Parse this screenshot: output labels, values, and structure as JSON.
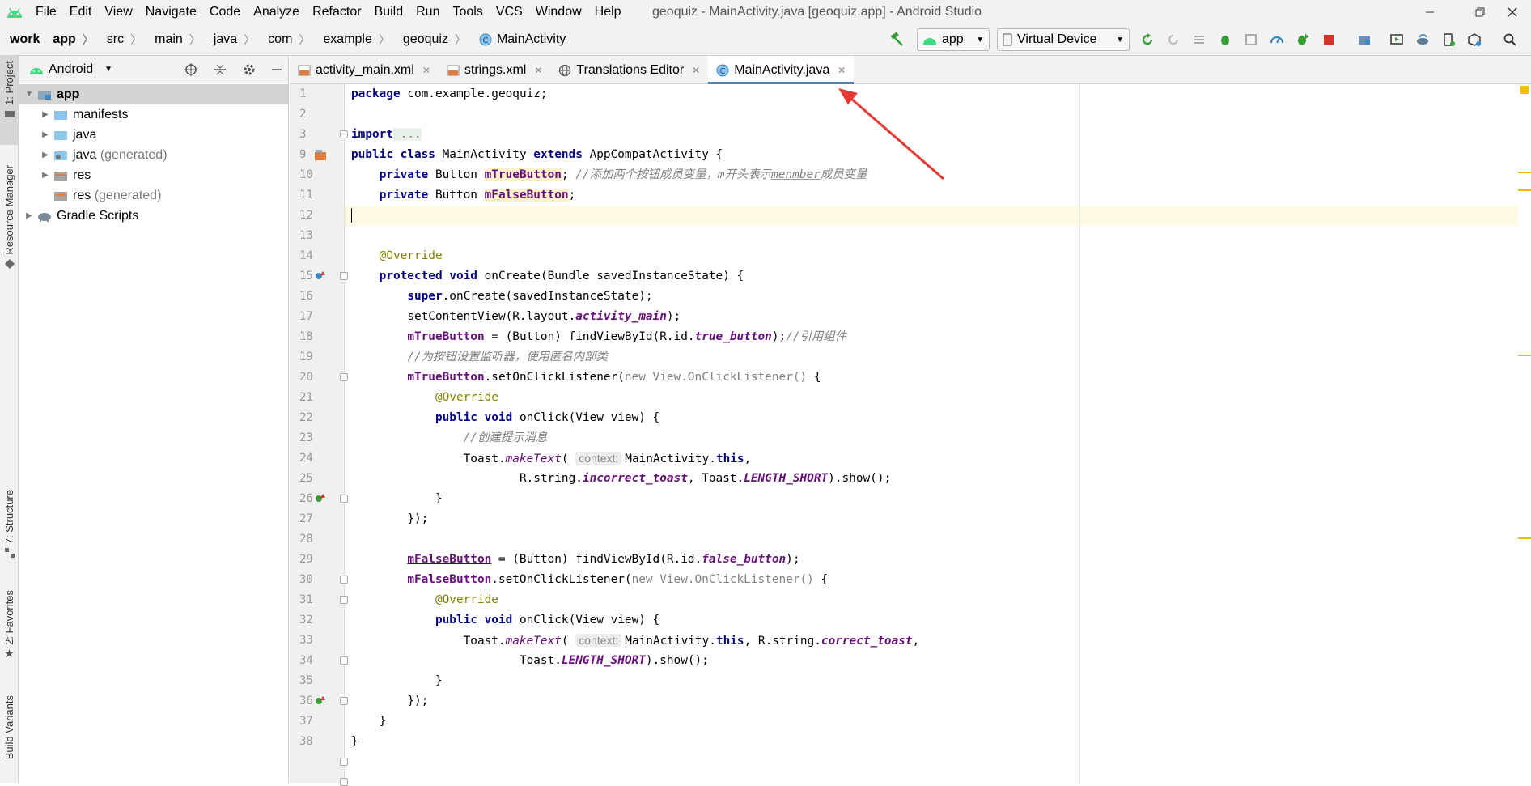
{
  "menu": {
    "items": [
      "File",
      "Edit",
      "View",
      "Navigate",
      "Code",
      "Analyze",
      "Refactor",
      "Build",
      "Run",
      "Tools",
      "VCS",
      "Window",
      "Help"
    ],
    "title": "geoquiz - MainActivity.java [geoquiz.app] - Android Studio"
  },
  "breadcrumbs": [
    "work",
    "app",
    "src",
    "main",
    "java",
    "com",
    "example",
    "geoquiz",
    "MainActivity"
  ],
  "toolbar": {
    "module": "app",
    "device": "Virtual Device"
  },
  "side_tabs": {
    "project": "1: Project",
    "resource_manager": "Resource Manager",
    "structure": "7: Structure",
    "favorites": "2: Favorites",
    "build_variants": "Build Variants"
  },
  "project_panel": {
    "view": "Android",
    "tree": [
      {
        "label": "app",
        "suffix": ""
      },
      {
        "label": "manifests",
        "suffix": ""
      },
      {
        "label": "java",
        "suffix": ""
      },
      {
        "label": "java",
        "suffix": "(generated)"
      },
      {
        "label": "res",
        "suffix": ""
      },
      {
        "label": "res",
        "suffix": "(generated)"
      },
      {
        "label": "Gradle Scripts",
        "suffix": ""
      }
    ]
  },
  "tabs": [
    "activity_main.xml",
    "strings.xml",
    "Translations Editor",
    "MainActivity.java"
  ],
  "line_numbers": [
    "1",
    "2",
    "3",
    "9",
    "10",
    "11",
    "12",
    "13",
    "14",
    "15",
    "16",
    "17",
    "18",
    "19",
    "20",
    "21",
    "22",
    "23",
    "24",
    "25",
    "26",
    "27",
    "28",
    "29",
    "30",
    "31",
    "32",
    "33",
    "34",
    "35",
    "36",
    "37",
    "38"
  ],
  "code": {
    "l1_kw": "package",
    "l1_rest": " com.example.geoquiz;",
    "l3_kw": "import",
    "l3_rest": " ...",
    "l9_kw1": "public",
    "l9_kw2": "class",
    "l9_name": " MainActivity ",
    "l9_kw3": "extends",
    "l9_rest": " AppCompatActivity {",
    "l10_kw": "private",
    "l10_type": " Button ",
    "l10_field": "mTrueButton",
    "l10_semi": ";",
    "l10_cmt_a": " //添加两个按钮成员变量，m开头表示",
    "l10_cmt_u": "menmber",
    "l10_cmt_b": "成员变量",
    "l11_kw": "private",
    "l11_type": " Button ",
    "l11_field": "mFalseButton",
    "l11_semi": ";",
    "l14": "@Override",
    "l15_kw1": "protected",
    "l15_kw2": "void",
    "l15_rest": " onCreate(Bundle savedInstanceState) {",
    "l16_kw": "super",
    "l16_rest": ".onCreate(savedInstanceState);",
    "l17_a": "setContentView(R.layout.",
    "l17_st": "activity_main",
    "l17_b": ");",
    "l18_field": "mTrueButton",
    "l18_a": " = (Button) findViewById(R.id.",
    "l18_st": "true_button",
    "l18_b": ");",
    "l18_cm": "//引用组件",
    "l19_cm": "//为按钮设置监听器，使用匿名内部类",
    "l20_field": "mTrueButton",
    "l20_a": ".setOnClickListener(",
    "l20_gr": "new View.OnClickListener()",
    "l20_b": " {",
    "l21": "@Override",
    "l22_kw1": "public",
    "l22_kw2": "void",
    "l22_rest": " onClick(View view) {",
    "l23_cm": "//创建提示消息",
    "l24_a": "Toast.",
    "l24_st": "makeText",
    "l24_b": "(",
    "l24_hint": "context:",
    "l24_c": "MainActivity.",
    "l24_kw": "this",
    "l24_d": ",",
    "l25_a": "R.string.",
    "l25_st": "incorrect_toast",
    "l25_b": ", Toast.",
    "l25_st2": "LENGTH_SHORT",
    "l25_c": ").show();",
    "l26": "}",
    "l27": "});",
    "l29_field": "mFalseButton",
    "l29_a": " = (Button) findViewById(R.id.",
    "l29_st": "false_button",
    "l29_b": ");",
    "l30_field": "mFalseButton",
    "l30_a": ".setOnClickListener(",
    "l30_gr": "new View.OnClickListener()",
    "l30_b": " {",
    "l31": "@Override",
    "l32_kw1": "public",
    "l32_kw2": "void",
    "l32_rest": " onClick(View view) {",
    "l33_a": "Toast.",
    "l33_st": "makeText",
    "l33_b": "(",
    "l33_hint": "context:",
    "l33_c": "MainActivity.",
    "l33_kw": "this",
    "l33_d": ", R.string.",
    "l33_st2": "correct_toast",
    "l33_e": ",",
    "l34_a": "Toast.",
    "l34_st": "LENGTH_SHORT",
    "l34_b": ").show();",
    "l35": "}",
    "l36": "});",
    "l37": "}",
    "l38": "}"
  },
  "colors": {
    "accent": "#4083c9",
    "annotation_arrow": "#e53935",
    "android_green": "#3ddc84"
  }
}
